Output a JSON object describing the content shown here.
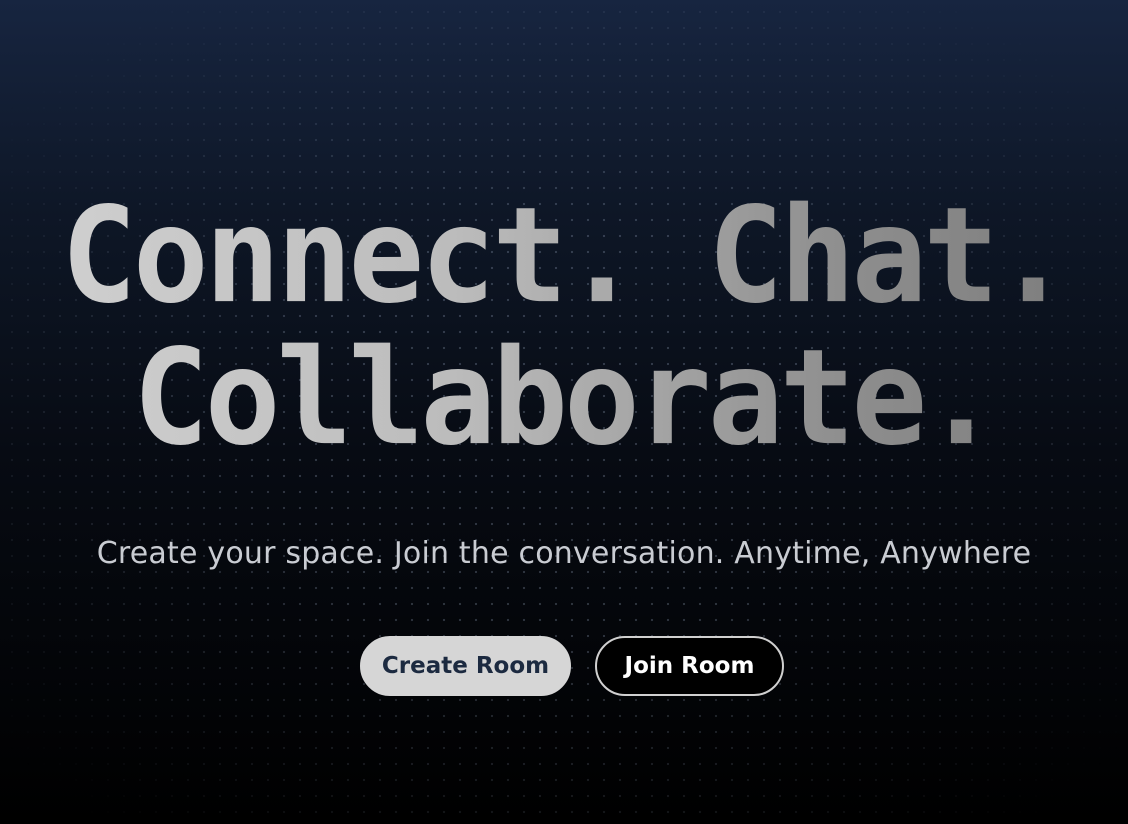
{
  "hero": {
    "headline_line1": "Connect. Chat.",
    "headline_line2": "Collaborate.",
    "subtitle": "Create your space. Join the conversation. Anytime, Anywhere"
  },
  "actions": {
    "create_room_label": "Create Room",
    "join_room_label": "Join Room"
  },
  "colors": {
    "background_top": "#172540",
    "background_bottom": "#000000",
    "headline_light": "#d2d2d2",
    "headline_dark": "#7a7a7a",
    "subtitle": "#c9ccd2",
    "create_button_bg": "#d6d6d6",
    "create_button_text": "#1c2a40",
    "join_button_border": "#d0d0d0",
    "join_button_text": "#ffffff"
  }
}
